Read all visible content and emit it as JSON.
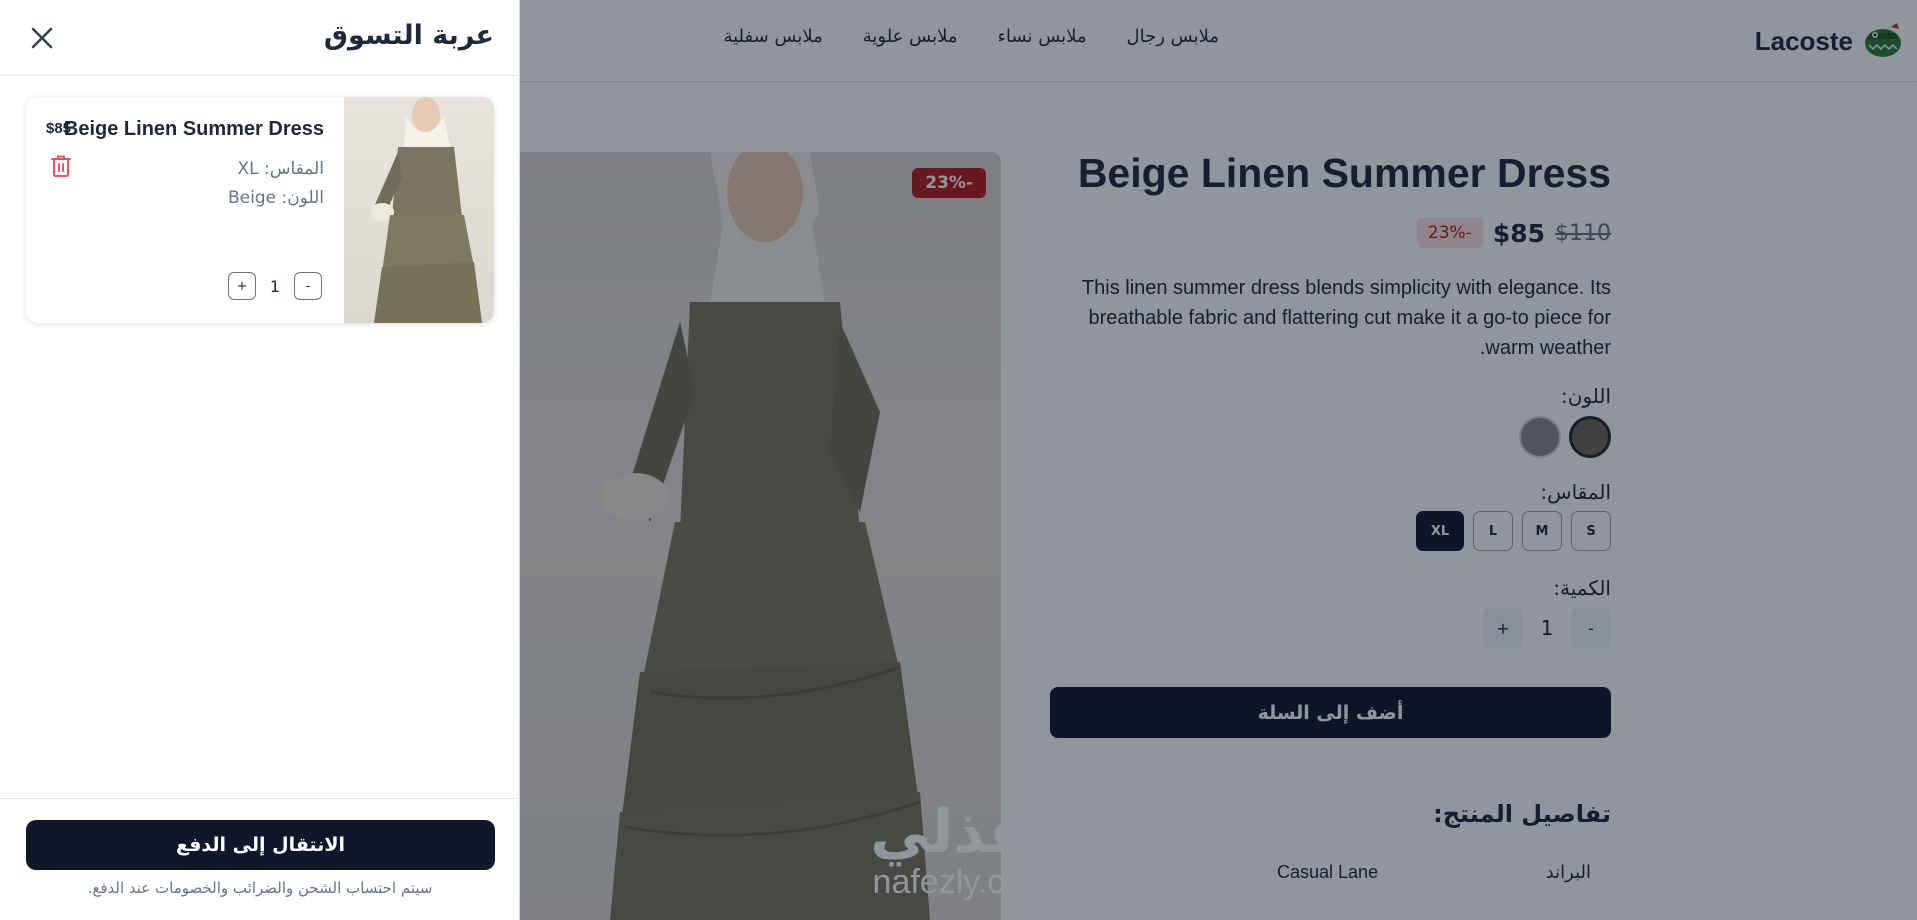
{
  "navbar": {
    "brand": "Lacoste",
    "links": [
      "ملابس رجال",
      "ملابس نساء",
      "ملابس علوية",
      "ملابس سفلية"
    ]
  },
  "product": {
    "discount_tag": "23%-",
    "title": "Beige Linen Summer Dress",
    "discount_badge": "23%-",
    "price": "$85",
    "old_price": "$110",
    "description": "This linen summer dress blends simplicity with elegance. Its breathable fabric and flattering cut make it a go-to piece for warm weather.",
    "color_label": "اللون:",
    "colors": [
      "#6b6956",
      "#8a8a8a"
    ],
    "size_label": "المقاس:",
    "sizes": [
      "S",
      "M",
      "L",
      "XL"
    ],
    "selected_size": "XL",
    "quantity_label": "الكمية:",
    "quantity": "1",
    "minus": "-",
    "plus": "+",
    "add_to_cart": "أضف إلى السلة",
    "details_title": "تفاصيل المنتج:",
    "details": {
      "brand_key": "البراند",
      "brand_value": "Casual Lane"
    }
  },
  "watermark": {
    "arabic": "نفذلي",
    "latin": "nafezly.com"
  },
  "cart": {
    "title": "عربة التسوق",
    "item": {
      "name": "Beige Linen Summer Dress",
      "price": "$85",
      "size": "المقاس: XL",
      "color": "اللون: Beige",
      "quantity": "1",
      "minus": "-",
      "plus": "+"
    },
    "checkout": "الانتقال إلى الدفع",
    "note": "سيتم احتساب الشحن والضرائب والخصومات عند الدفع."
  },
  "colors": {
    "primary": "#0f172a",
    "discount": "#b91c1c",
    "trash": "#e05a5a",
    "text": "#1e293b"
  },
  "icons": [
    "crocodile-logo-icon",
    "close-icon",
    "trash-icon"
  ]
}
